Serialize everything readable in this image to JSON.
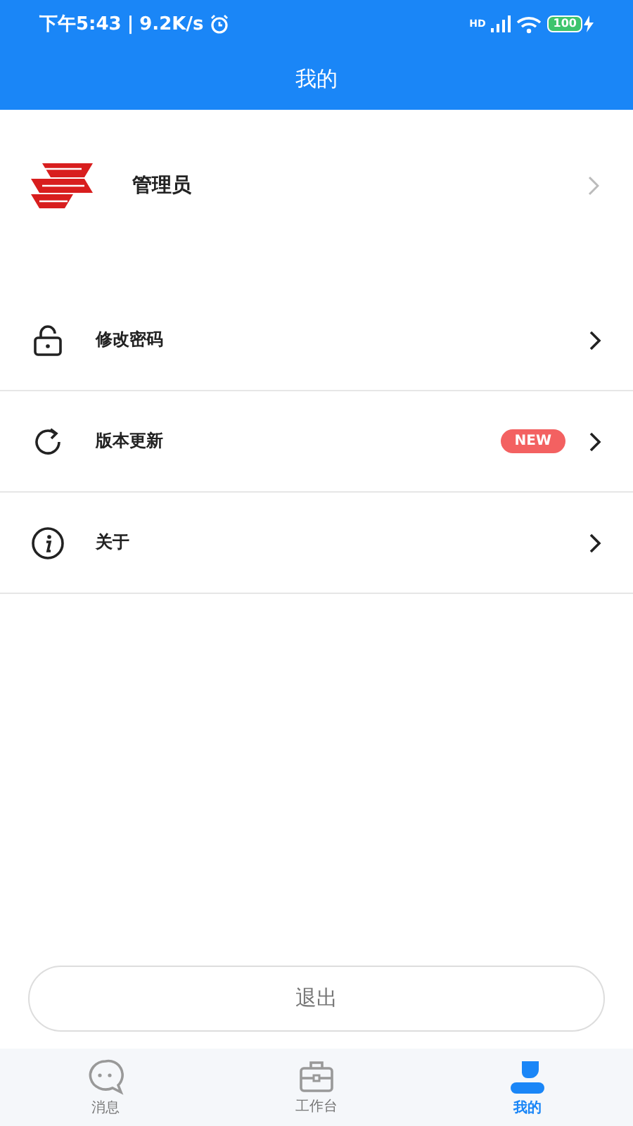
{
  "status_bar": {
    "time": "下午5:43",
    "separator": "|",
    "speed": "9.2K/s",
    "battery": "100",
    "network": "HD"
  },
  "header": {
    "title": "我的"
  },
  "profile": {
    "name": "管理员"
  },
  "menu": [
    {
      "label": "修改密码"
    },
    {
      "label": "版本更新",
      "badge": "NEW"
    },
    {
      "label": "关于"
    }
  ],
  "logout": {
    "label": "退出"
  },
  "tabs": [
    {
      "label": "消息",
      "selected": false
    },
    {
      "label": "工作台",
      "selected": false
    },
    {
      "label": "我的",
      "selected": true
    }
  ]
}
